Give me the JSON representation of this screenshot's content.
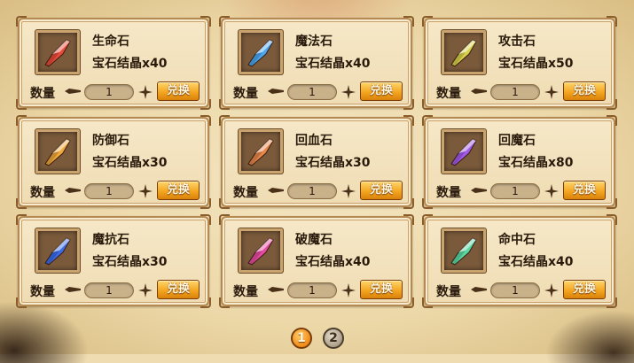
{
  "labels": {
    "quantity": "数量",
    "exchange": "兑换"
  },
  "items": [
    {
      "name": "生命石",
      "cost": "宝石结晶x40",
      "quantity": "1",
      "gem_color": "#e84a3a"
    },
    {
      "name": "魔法石",
      "cost": "宝石结晶x40",
      "quantity": "1",
      "gem_color": "#4aa6f0"
    },
    {
      "name": "攻击石",
      "cost": "宝石结晶x50",
      "quantity": "1",
      "gem_color": "#d8d24a"
    },
    {
      "name": "防御石",
      "cost": "宝石结晶x30",
      "quantity": "1",
      "gem_color": "#f0a83a"
    },
    {
      "name": "回血石",
      "cost": "宝石结晶x30",
      "quantity": "1",
      "gem_color": "#e8864a"
    },
    {
      "name": "回魔石",
      "cost": "宝石结晶x80",
      "quantity": "1",
      "gem_color": "#a25ae8"
    },
    {
      "name": "魔抗石",
      "cost": "宝石结晶x30",
      "quantity": "1",
      "gem_color": "#3a6ae8"
    },
    {
      "name": "破魔石",
      "cost": "宝石结晶x40",
      "quantity": "1",
      "gem_color": "#e84aa2"
    },
    {
      "name": "命中石",
      "cost": "宝石结晶x40",
      "quantity": "1",
      "gem_color": "#5ad8a2"
    }
  ],
  "pagination": {
    "pages": [
      "1",
      "2"
    ],
    "current": "1"
  }
}
